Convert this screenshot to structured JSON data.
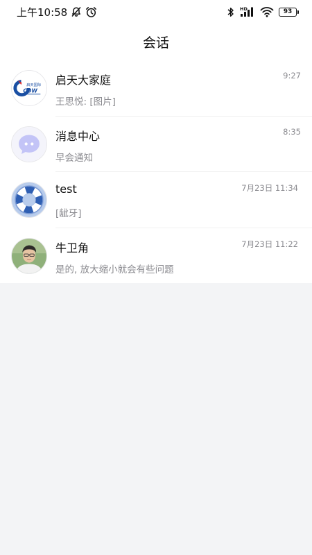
{
  "status_bar": {
    "time": "上午10:58",
    "icons": [
      "bell-off-icon",
      "alarm-icon",
      "bluetooth-icon",
      "signal-icon",
      "wifi-icon",
      "battery-icon"
    ],
    "network_badge": "HD",
    "battery_level": "93"
  },
  "header": {
    "title": "会话"
  },
  "conversations": [
    {
      "name": "启天大家庭",
      "preview": "王思悦: [图片]",
      "time": "9:27",
      "avatar_text": "启天国际",
      "avatar_logo": "CDW",
      "avatar": "group-logo"
    },
    {
      "name": "消息中心",
      "preview": "早会通知",
      "time": "8:35",
      "avatar": "chat-bubble"
    },
    {
      "name": "test",
      "preview": "[龇牙]",
      "time": "7月23日 11:34",
      "avatar": "lifebuoy"
    },
    {
      "name": "牛卫角",
      "preview": "是的, 放大缩小就会有些问题",
      "time": "7月23日 11:22",
      "avatar": "person-photo"
    }
  ],
  "colors": {
    "background": "#f3f4f6",
    "card": "#ffffff",
    "text_primary": "#111111",
    "text_secondary": "#8a8a8f",
    "logo_blue": "#1a4fa3",
    "logo_red": "#d8262d",
    "bubble_purple": "#c3c4f7"
  }
}
